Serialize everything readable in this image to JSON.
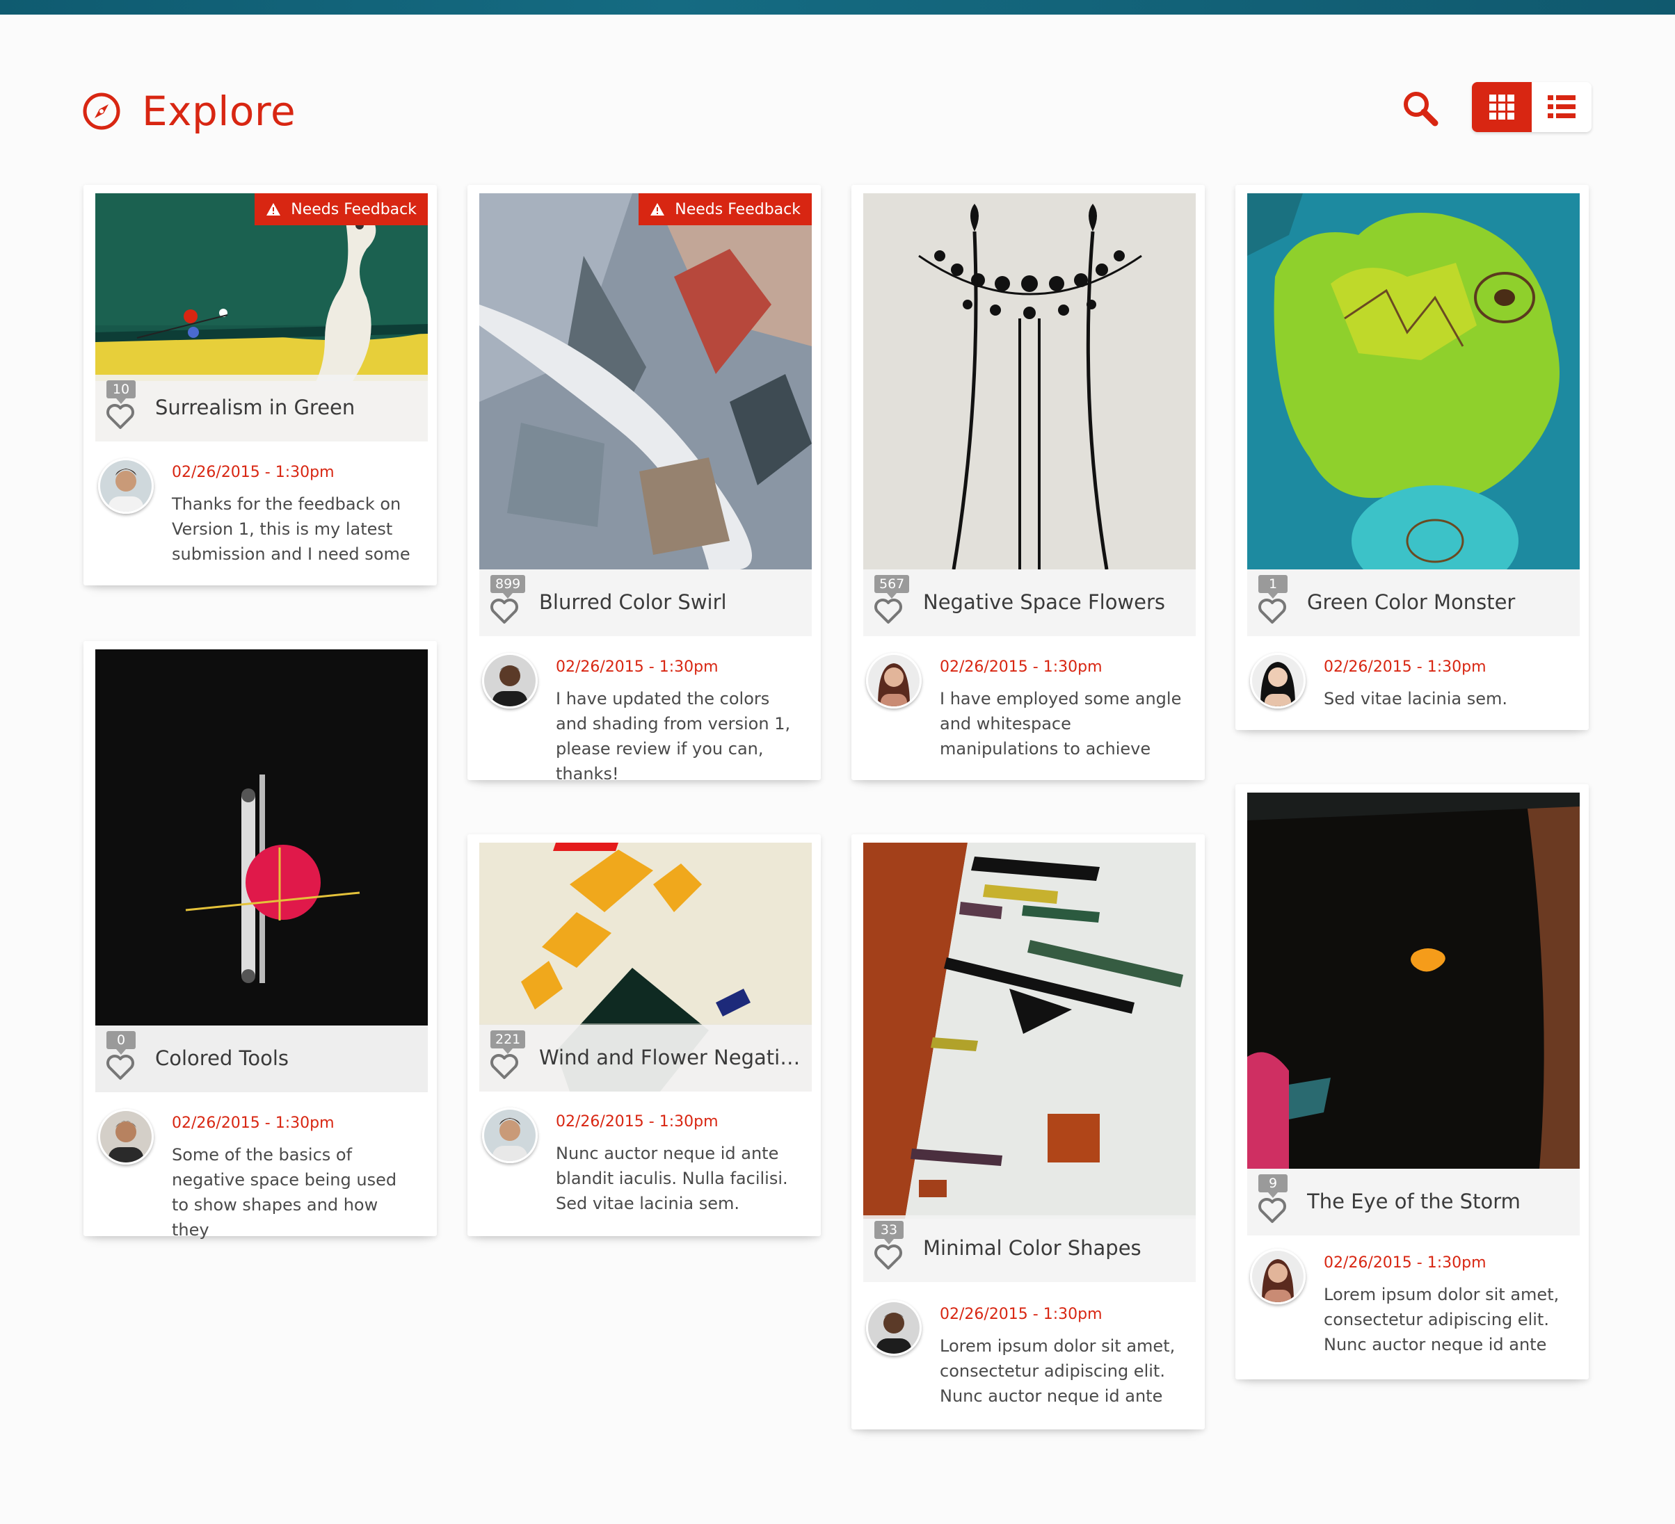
{
  "header": {
    "title": "Explore",
    "icon": "compass-icon",
    "accent_color": "#d82612"
  },
  "toolbar": {
    "search_icon": "search-icon",
    "grid_view_icon": "grid-view-icon",
    "list_view_icon": "list-view-icon",
    "active_view": "grid"
  },
  "cards": [
    {
      "title": "Surrealism in Green",
      "likes": "10",
      "badge": "Needs Feedback",
      "date": "02/26/2015 - 1:30pm",
      "comment": "Thanks for the feedback on Version 1, this is my latest submission and I need some"
    },
    {
      "title": "Colored Tools",
      "likes": "0",
      "badge": "",
      "date": "02/26/2015 - 1:30pm",
      "comment": "Some of the basics of negative space being used to show shapes and how they"
    },
    {
      "title": "Blurred Color Swirl",
      "likes": "899",
      "badge": "Needs Feedback",
      "date": "02/26/2015 - 1:30pm",
      "comment": "I have updated the colors and shading from version 1, please review if you can, thanks!"
    },
    {
      "title": "Wind and Flower Negative ...",
      "likes": "221",
      "badge": "",
      "date": "02/26/2015 - 1:30pm",
      "comment": "Nunc auctor neque id ante blandit iaculis. Nulla facilisi. Sed vitae lacinia sem."
    },
    {
      "title": "Negative Space Flowers",
      "likes": "567",
      "badge": "",
      "date": "02/26/2015 - 1:30pm",
      "comment": "I have employed some angle and whitespace manipulations to achieve"
    },
    {
      "title": "Minimal Color Shapes",
      "likes": "33",
      "badge": "",
      "date": "02/26/2015 - 1:30pm",
      "comment": "Lorem ipsum dolor sit amet, consectetur adipiscing elit. Nunc auctor neque id ante"
    },
    {
      "title": "Green Color Monster",
      "likes": "1",
      "badge": "",
      "date": "02/26/2015 - 1:30pm",
      "comment": "Sed vitae lacinia sem."
    },
    {
      "title": "The Eye of the Storm",
      "likes": "9",
      "badge": "",
      "date": "02/26/2015 - 1:30pm",
      "comment": "Lorem ipsum dolor sit amet, consectetur adipiscing elit. Nunc auctor neque id ante"
    }
  ]
}
